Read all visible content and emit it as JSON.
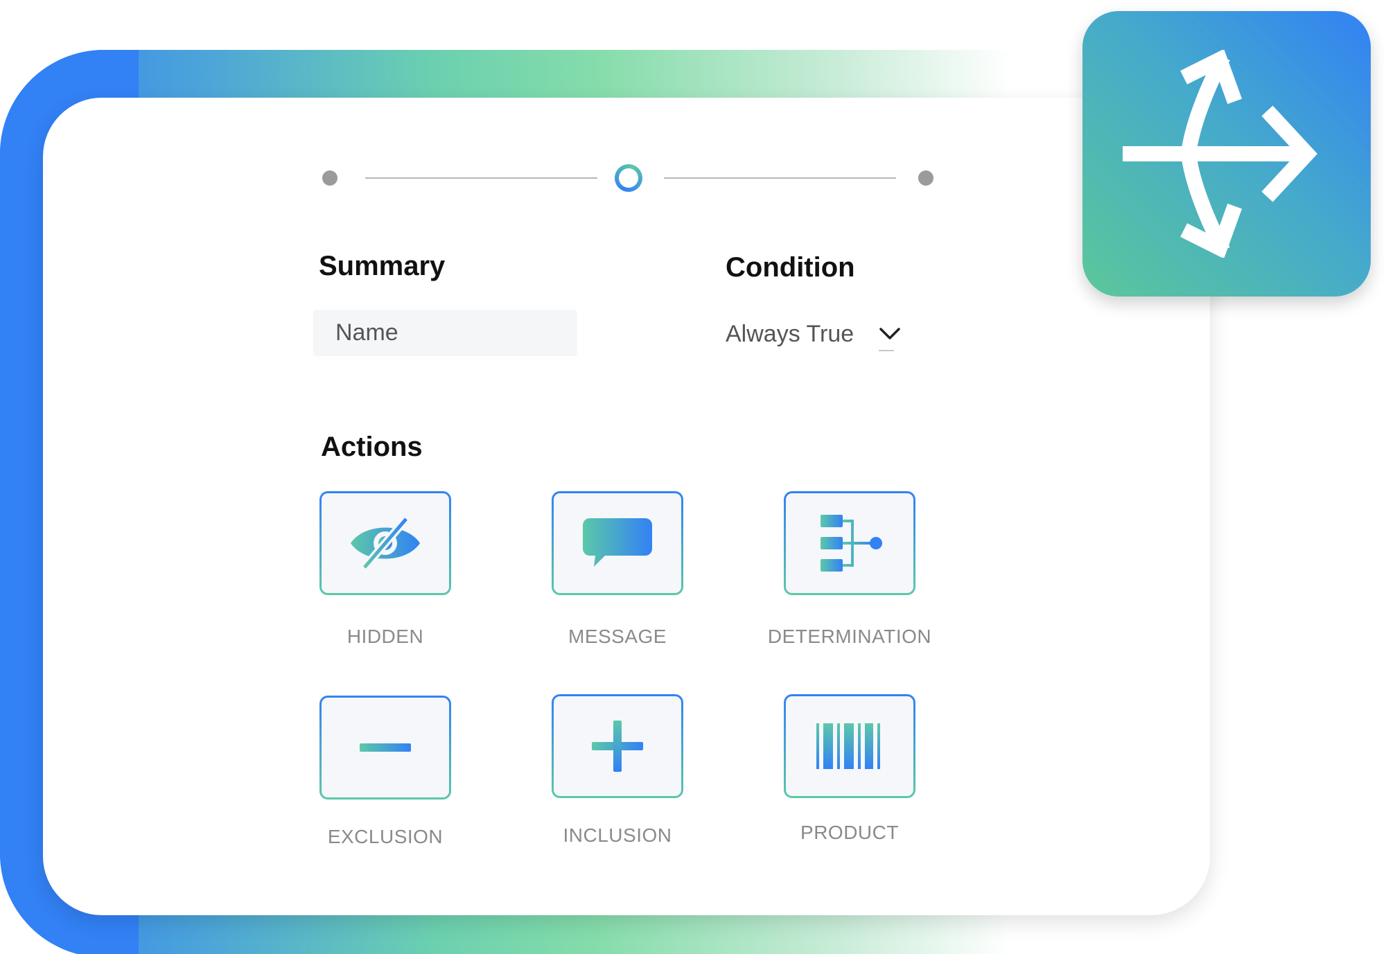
{
  "stepper": {
    "steps": [
      "step-1",
      "step-2",
      "step-3"
    ],
    "active_step": 2
  },
  "summary": {
    "heading": "Summary",
    "name_placeholder": "Name"
  },
  "condition": {
    "heading": "Condition",
    "selected": "Always True"
  },
  "actions": {
    "heading": "Actions",
    "items": [
      {
        "label": "HIDDEN",
        "icon": "eye-slash-icon"
      },
      {
        "label": "MESSAGE",
        "icon": "chat-bubble-icon"
      },
      {
        "label": "DETERMINATION",
        "icon": "flow-tree-icon"
      },
      {
        "label": "EXCLUSION",
        "icon": "minus-icon"
      },
      {
        "label": "INCLUSION",
        "icon": "plus-icon"
      },
      {
        "label": "PRODUCT",
        "icon": "barcode-icon"
      }
    ]
  },
  "badge": {
    "icon": "branch-arrows-icon"
  },
  "colors": {
    "accent_blue": "#3281f5",
    "accent_green": "#5cc8a8",
    "label_gray": "#8a8a8a"
  }
}
